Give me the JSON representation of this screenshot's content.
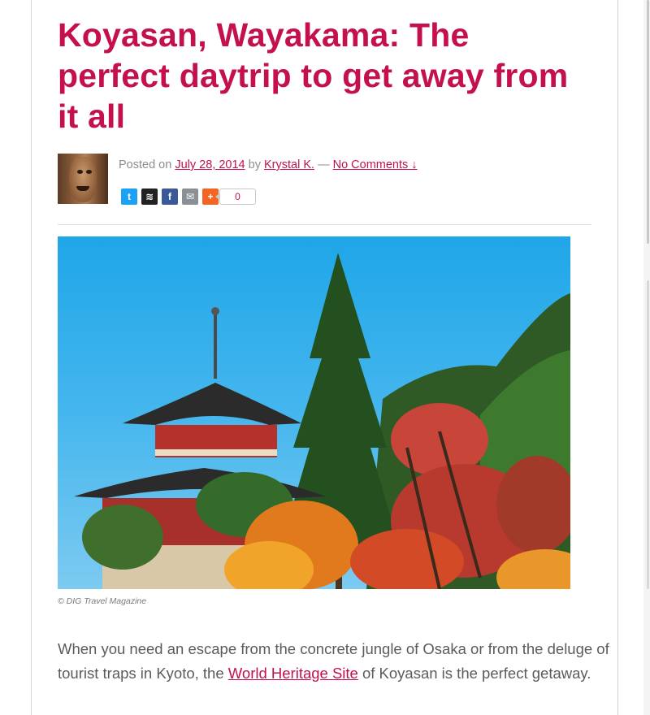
{
  "article": {
    "title": "Koyasan, Wayakama: The perfect daytrip to get away from it all",
    "meta": {
      "posted_on_label": "Posted on",
      "date": "July 28, 2014",
      "by_label": "by",
      "author": "Krystal K.",
      "separator": "—",
      "comments_link": "No Comments ↓"
    },
    "share": {
      "buttons": [
        {
          "name": "twitter",
          "glyph": "t",
          "color": "#1da1f2"
        },
        {
          "name": "buffer",
          "glyph": "≋",
          "color": "#222222"
        },
        {
          "name": "facebook",
          "glyph": "f",
          "color": "#3b5998"
        },
        {
          "name": "email",
          "glyph": "✉",
          "color": "#8a9095"
        },
        {
          "name": "more",
          "glyph": "+",
          "color": "#f26522"
        }
      ],
      "count": "0"
    },
    "image": {
      "subject": "pagoda-autumn-foliage"
    },
    "caption": "© DIG Travel Magazine",
    "intro": {
      "before_link": "When you need an escape from the concrete jungle of Osaka or from the deluge of tourist traps in Kyoto, the ",
      "link_text": "World Heritage Site",
      "after_link": " of Koyasan is the perfect getaway."
    }
  },
  "theme": {
    "accent": "#c4104f",
    "meta_text": "#8d8d8d",
    "body_text": "#5b5b5b"
  }
}
